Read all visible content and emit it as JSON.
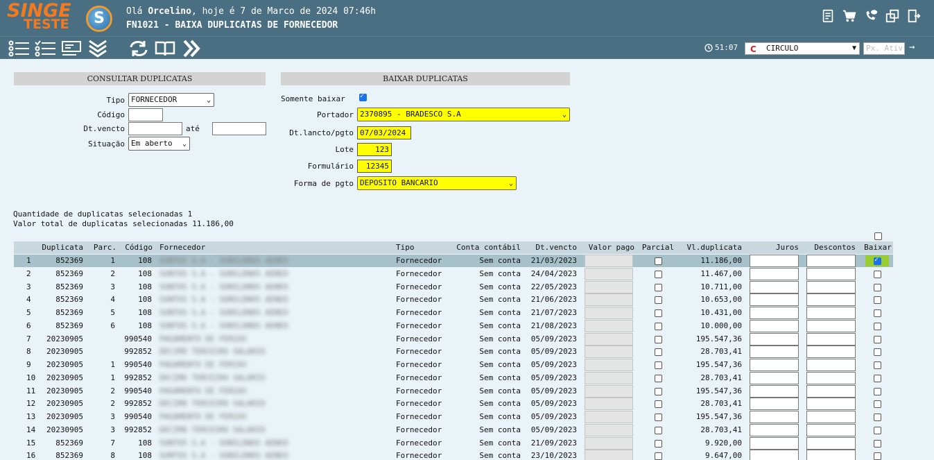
{
  "header": {
    "logo_text_1": "SINGE",
    "logo_text_2": "TESTE",
    "logo_mark": "S",
    "greeting_prefix": "Olá ",
    "user": "Orcelino",
    "greeting_suffix": ", hoje é 7 de Marco de 2024 07:46h",
    "form_title": "FN1021 - BAIXA DUPLICATAS DE FORNECEDOR",
    "icons": [
      "document-icon",
      "cart-icon",
      "phone-chat-icon",
      "window-switch-icon",
      "logout-icon"
    ]
  },
  "toolbar": {
    "icons": [
      "list-icon",
      "checklist-icon",
      "card-icon",
      "chevrons-down-icon",
      "refresh-icon",
      "book-icon",
      "chevrons-right-icon"
    ],
    "timer": "51:07",
    "company": "CIRCULO",
    "company_logo": "C",
    "next_placeholder": "Px. Ativ",
    "next_arrow": "→"
  },
  "consultar": {
    "title": "CONSULTAR DUPLICATAS",
    "tipo_label": "Tipo",
    "tipo_value": "FORNECEDOR",
    "codigo_label": "Código",
    "codigo_value": "",
    "dtvencto_label": "Dt.vencto",
    "ate_label": "até",
    "dtvencto_from": "",
    "dtvencto_to": "",
    "situacao_label": "Situação",
    "situacao_value": "Em aberto"
  },
  "baixar": {
    "title": "BAIXAR DUPLICATAS",
    "somente_label": "Somente baixar",
    "somente_checked": true,
    "portador_label": "Portador",
    "portador_value": "2370895 - BRADESCO S.A",
    "dtlancto_label": "Dt.lancto/pgto",
    "dtlancto_value": "07/03/2024",
    "lote_label": "Lote",
    "lote_value": "123",
    "formulario_label": "Formulário",
    "formulario_value": "12345",
    "forma_label": "Forma de pgto",
    "forma_value": "DEPOSITO BANCARIO"
  },
  "summary": {
    "qtd": "Quantidade de duplicatas selecionadas 1",
    "valor": "Valor total de duplicatas selecionadas 11.186,00"
  },
  "table": {
    "headers": {
      "duplicata": "Duplicata",
      "parc": "Parc.",
      "codigo": "Código",
      "fornecedor": "Fornecedor",
      "tipo": "Tipo",
      "conta": "Conta contábil",
      "dtvencto": "Dt.vencto",
      "valor_pago": "Valor pago",
      "parcial": "Parcial",
      "vl_duplicata": "Vl.duplicata",
      "juros": "Juros",
      "descontos": "Descontos",
      "baixar": "Baixar"
    },
    "rows": [
      {
        "n": "1",
        "dup": "852369",
        "parc": "1",
        "cod": "108",
        "forn": "SUNTOS S.A - SUNILDNOS AENEO",
        "tipo": "Fornecedor",
        "conta": "Sem conta",
        "dt": "21/03/2023",
        "vl": "11.186,00",
        "baixar": true
      },
      {
        "n": "2",
        "dup": "852369",
        "parc": "2",
        "cod": "108",
        "forn": "SUNTOS S.A - SUNILDNOS AENEO",
        "tipo": "Fornecedor",
        "conta": "Sem conta",
        "dt": "24/04/2023",
        "vl": "11.467,00",
        "baixar": false
      },
      {
        "n": "3",
        "dup": "852369",
        "parc": "3",
        "cod": "108",
        "forn": "SUNTOS S.A - SUNILDNOS AENEO",
        "tipo": "Fornecedor",
        "conta": "Sem conta",
        "dt": "22/05/2023",
        "vl": "10.711,00",
        "baixar": false
      },
      {
        "n": "4",
        "dup": "852369",
        "parc": "4",
        "cod": "108",
        "forn": "SUNTOS S.A - SUNILDNOS AENEO",
        "tipo": "Fornecedor",
        "conta": "Sem conta",
        "dt": "21/06/2023",
        "vl": "10.653,00",
        "baixar": false
      },
      {
        "n": "5",
        "dup": "852369",
        "parc": "5",
        "cod": "108",
        "forn": "SUNTOS S.A - SUNILDNOS AENEO",
        "tipo": "Fornecedor",
        "conta": "Sem conta",
        "dt": "21/07/2023",
        "vl": "10.431,00",
        "baixar": false
      },
      {
        "n": "6",
        "dup": "852369",
        "parc": "6",
        "cod": "108",
        "forn": "SUNTOS S.A - SUNILDNOS AENEO",
        "tipo": "Fornecedor",
        "conta": "Sem conta",
        "dt": "21/08/2023",
        "vl": "10.000,00",
        "baixar": false
      },
      {
        "n": "7",
        "dup": "20230905",
        "parc": "",
        "cod": "990540",
        "forn": "PAGAMENTO DE FERIAS",
        "tipo": "Fornecedor",
        "conta": "Sem conta",
        "dt": "05/09/2023",
        "vl": "195.547,36",
        "baixar": false
      },
      {
        "n": "8",
        "dup": "20230905",
        "parc": "",
        "cod": "992852",
        "forn": "DECIMO TERCEIRO SALARIO",
        "tipo": "Fornecedor",
        "conta": "Sem conta",
        "dt": "05/09/2023",
        "vl": "28.703,41",
        "baixar": false
      },
      {
        "n": "9",
        "dup": "20230905",
        "parc": "1",
        "cod": "990540",
        "forn": "PAGAMENTO DE FERIAS",
        "tipo": "Fornecedor",
        "conta": "Sem conta",
        "dt": "05/09/2023",
        "vl": "195.547,36",
        "baixar": false
      },
      {
        "n": "10",
        "dup": "20230905",
        "parc": "1",
        "cod": "992852",
        "forn": "DECIMO TERCEIRO SALARIO",
        "tipo": "Fornecedor",
        "conta": "Sem conta",
        "dt": "05/09/2023",
        "vl": "28.703,41",
        "baixar": false
      },
      {
        "n": "11",
        "dup": "20230905",
        "parc": "2",
        "cod": "990540",
        "forn": "PAGAMENTO DE FERIAS",
        "tipo": "Fornecedor",
        "conta": "Sem conta",
        "dt": "05/09/2023",
        "vl": "195.547,36",
        "baixar": false
      },
      {
        "n": "12",
        "dup": "20230905",
        "parc": "2",
        "cod": "992852",
        "forn": "DECIMO TERCEIRO SALARIO",
        "tipo": "Fornecedor",
        "conta": "Sem conta",
        "dt": "05/09/2023",
        "vl": "28.703,41",
        "baixar": false
      },
      {
        "n": "13",
        "dup": "20230905",
        "parc": "3",
        "cod": "990540",
        "forn": "PAGAMENTO DE FERIAS",
        "tipo": "Fornecedor",
        "conta": "Sem conta",
        "dt": "05/09/2023",
        "vl": "195.547,36",
        "baixar": false
      },
      {
        "n": "14",
        "dup": "20230905",
        "parc": "3",
        "cod": "992852",
        "forn": "DECIMO TERCEIRO SALARIO",
        "tipo": "Fornecedor",
        "conta": "Sem conta",
        "dt": "05/09/2023",
        "vl": "28.703,41",
        "baixar": false
      },
      {
        "n": "15",
        "dup": "852369",
        "parc": "7",
        "cod": "108",
        "forn": "SUNTOS S.A - SUNILDNOS AENEO",
        "tipo": "Fornecedor",
        "conta": "Sem conta",
        "dt": "21/09/2023",
        "vl": "9.920,00",
        "baixar": false
      },
      {
        "n": "16",
        "dup": "852369",
        "parc": "8",
        "cod": "108",
        "forn": "SUNTOS S.A - SUNILDNOS AENEO",
        "tipo": "Fornecedor",
        "conta": "Sem conta",
        "dt": "23/10/2023",
        "vl": "9.647,00",
        "baixar": false
      }
    ]
  }
}
